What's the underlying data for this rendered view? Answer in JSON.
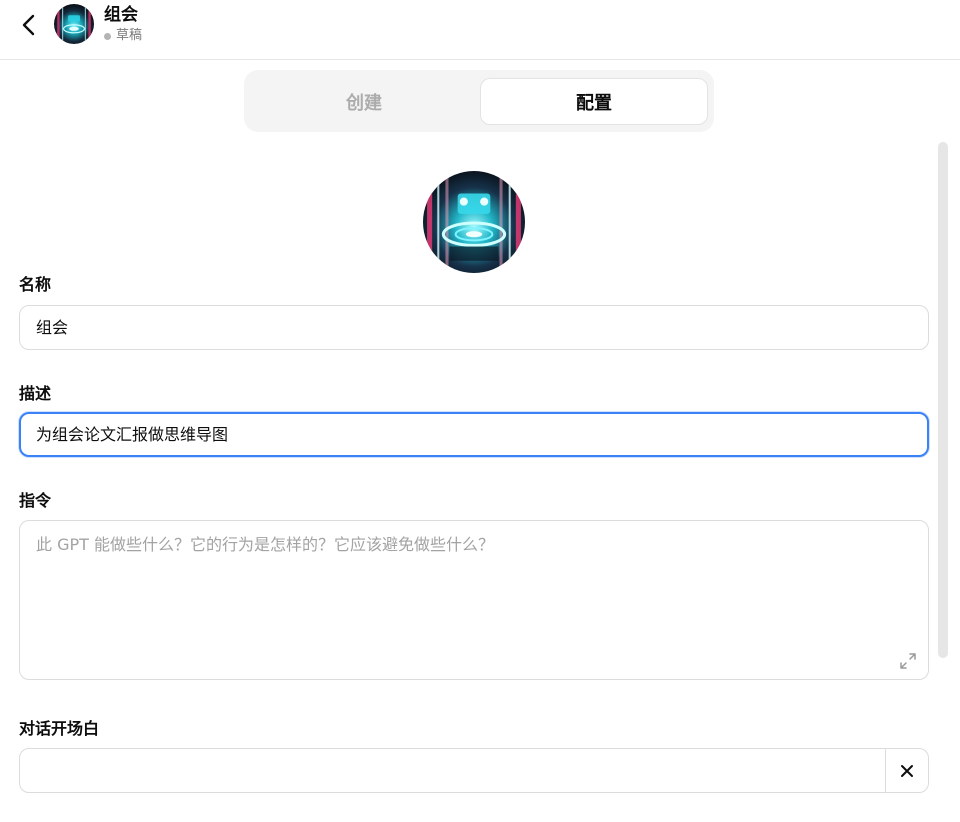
{
  "header": {
    "title": "组会",
    "status": "草稿"
  },
  "tabs": [
    {
      "label": "创建",
      "active": false
    },
    {
      "label": "配置",
      "active": true
    }
  ],
  "form": {
    "name": {
      "label": "名称",
      "value": "组会"
    },
    "description": {
      "label": "描述",
      "value": "为组会论文汇报做思维导图"
    },
    "instructions": {
      "label": "指令",
      "value": "",
      "placeholder": "此 GPT 能做些什么？它的行为是怎样的？它应该避免做些什么？"
    },
    "conversation_starters": {
      "label": "对话开场白",
      "value": ""
    }
  },
  "colors": {
    "focus_border": "#3b82f6",
    "status_dot": "#b4b4b4"
  },
  "icons": {
    "back": "chevron-left-icon",
    "expand": "expand-icon",
    "clear": "close-icon"
  }
}
